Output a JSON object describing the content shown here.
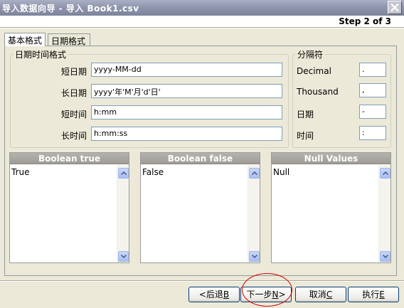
{
  "window": {
    "title": "导入数据向导 - 导入 Book1.csv",
    "close_icon": "close-icon"
  },
  "header": {
    "step": "Step 2 of 3"
  },
  "tabs": [
    {
      "label": "基本格式",
      "active": true
    },
    {
      "label": "日期格式",
      "active": false
    }
  ],
  "datetime_group": {
    "legend": "日期时间格式",
    "fields": [
      {
        "label": "短日期",
        "value": "yyyy-MM-dd"
      },
      {
        "label": "长日期",
        "value": "yyyy'年'M'月'd'日'"
      },
      {
        "label": "短时间",
        "value": "h:mm"
      },
      {
        "label": "长时间",
        "value": "h:mm:ss"
      }
    ]
  },
  "separator_group": {
    "legend": "分隔符",
    "fields": [
      {
        "label": "Decimal",
        "value": "."
      },
      {
        "label": "Thousand",
        "value": ","
      },
      {
        "label": "日期",
        "value": "-"
      },
      {
        "label": "时间",
        "value": ":"
      }
    ]
  },
  "lists": [
    {
      "header": "Boolean true",
      "value": "True"
    },
    {
      "header": "Boolean false",
      "value": "False"
    },
    {
      "header": "Null Values",
      "value": "Null"
    }
  ],
  "buttons": {
    "back": {
      "label": "<后退",
      "key": "B"
    },
    "next": {
      "label": "下一步",
      "key": "N",
      "suffix": ">"
    },
    "cancel": {
      "label": "取消",
      "key": "C"
    },
    "execute": {
      "label": "执行",
      "key": "E"
    }
  },
  "colors": {
    "highlight_ellipse": "#d40000",
    "titlebar": "#8d94ab"
  }
}
